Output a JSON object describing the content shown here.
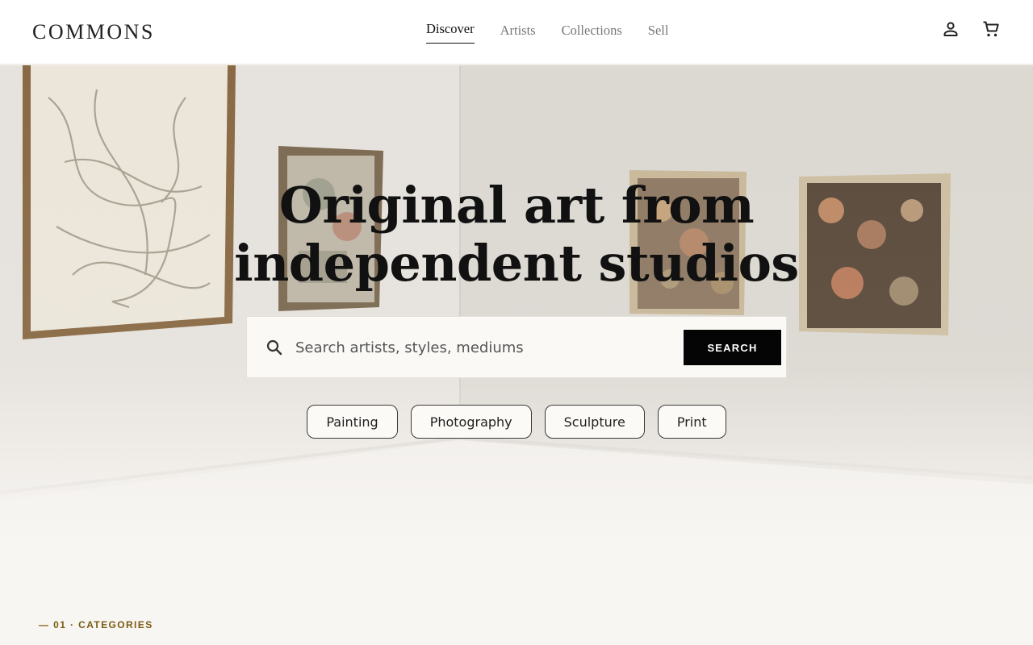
{
  "header": {
    "logo": "COMMONS",
    "nav": [
      {
        "label": "Discover",
        "active": true
      },
      {
        "label": "Artists",
        "active": false
      },
      {
        "label": "Collections",
        "active": false
      },
      {
        "label": "Sell",
        "active": false
      }
    ],
    "icons": [
      "account-icon",
      "cart-icon"
    ]
  },
  "hero": {
    "title_line1": "Original art from",
    "title_line2": "independent studios",
    "search": {
      "placeholder": "Search artists, styles, mediums",
      "value": "",
      "button_label": "SEARCH"
    },
    "chips": [
      "Painting",
      "Photography",
      "Sculpture",
      "Print"
    ]
  },
  "section": {
    "label": "— 01 · CATEGORIES"
  },
  "colors": {
    "accent": "#7b5a12",
    "button_bg": "#050505",
    "page_bg": "#f8f6f3"
  }
}
